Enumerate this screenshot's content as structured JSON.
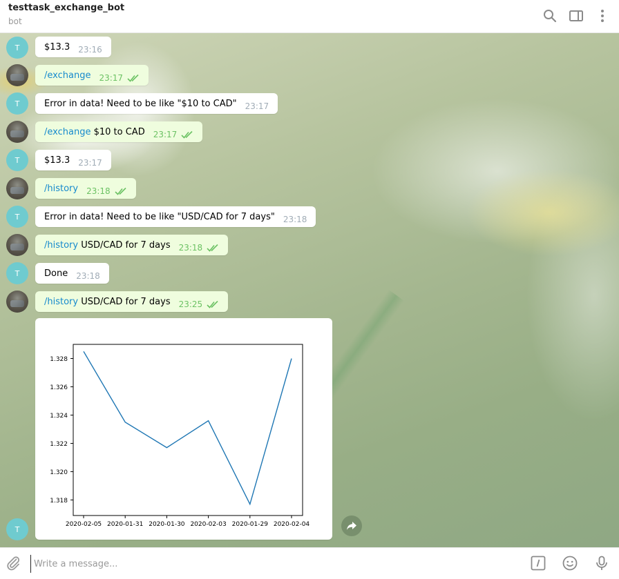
{
  "header": {
    "title": "testtask_exchange_bot",
    "subtitle": "bot"
  },
  "messages": [
    {
      "from": "bot",
      "text": "$13.3",
      "time": "23:16"
    },
    {
      "from": "user",
      "command": "/exchange",
      "text": "",
      "time": "23:17"
    },
    {
      "from": "bot",
      "text": "Error in data! Need to be like \"$10 to CAD\"",
      "time": "23:17"
    },
    {
      "from": "user",
      "command": "/exchange",
      "text": " $10 to CAD",
      "time": "23:17"
    },
    {
      "from": "bot",
      "text": "$13.3",
      "time": "23:17"
    },
    {
      "from": "user",
      "command": "/history",
      "text": "",
      "time": "23:18"
    },
    {
      "from": "bot",
      "text": "Error in data! Need to be like \"USD/CAD for 7 days\"",
      "time": "23:18"
    },
    {
      "from": "user",
      "command": "/history",
      "text": " USD/CAD for 7 days",
      "time": "23:18"
    },
    {
      "from": "bot",
      "text": "Done",
      "time": "23:18"
    },
    {
      "from": "user",
      "command": "/history",
      "text": " USD/CAD for 7 days",
      "time": "23:25"
    }
  ],
  "avatar_letter": "T",
  "input": {
    "placeholder": "Write a message..."
  },
  "colors": {
    "link": "#168acd",
    "user_bubble": "#effdde",
    "check": "#6cc264",
    "line": "#1f77b4"
  },
  "chart_data": {
    "type": "line",
    "categories": [
      "2020-02-05",
      "2020-01-31",
      "2020-01-30",
      "2020-02-03",
      "2020-01-29",
      "2020-02-04"
    ],
    "values": [
      1.3285,
      1.3235,
      1.3217,
      1.3236,
      1.3177,
      1.328
    ],
    "yticks": [
      "1.318",
      "1.320",
      "1.322",
      "1.324",
      "1.326",
      "1.328"
    ],
    "ylim": [
      1.3169,
      1.329
    ],
    "title": "",
    "xlabel": "",
    "ylabel": ""
  }
}
